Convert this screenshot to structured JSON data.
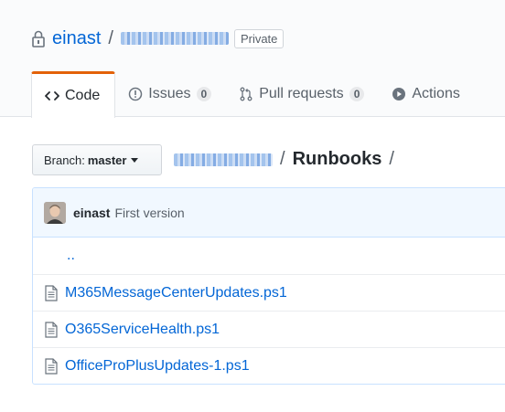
{
  "repo": {
    "owner": "einast",
    "separator": "/",
    "visibility_badge": "Private"
  },
  "tabs": [
    {
      "label": "Code",
      "icon": "code-icon",
      "selected": true
    },
    {
      "label": "Issues",
      "icon": "issue-icon",
      "count": "0"
    },
    {
      "label": "Pull requests",
      "icon": "pull-request-icon",
      "count": "0"
    },
    {
      "label": "Actions",
      "icon": "play-icon"
    }
  ],
  "branch": {
    "prefix": "Branch:",
    "name": "master"
  },
  "breadcrumb": {
    "separator": "/",
    "current": "Runbooks",
    "trailing": "/"
  },
  "commit": {
    "author": "einast",
    "message": "First version"
  },
  "files": {
    "parent_link": "..",
    "items": [
      {
        "name": "M365MessageCenterUpdates.ps1",
        "icon": "file-icon"
      },
      {
        "name": "O365ServiceHealth.ps1",
        "icon": "file-icon"
      },
      {
        "name": "OfficeProPlusUpdates-1.ps1",
        "icon": "file-icon"
      }
    ]
  },
  "colors": {
    "link": "#0366d6",
    "tab_accent": "#e36209",
    "commit_bg": "#f1f8ff"
  }
}
